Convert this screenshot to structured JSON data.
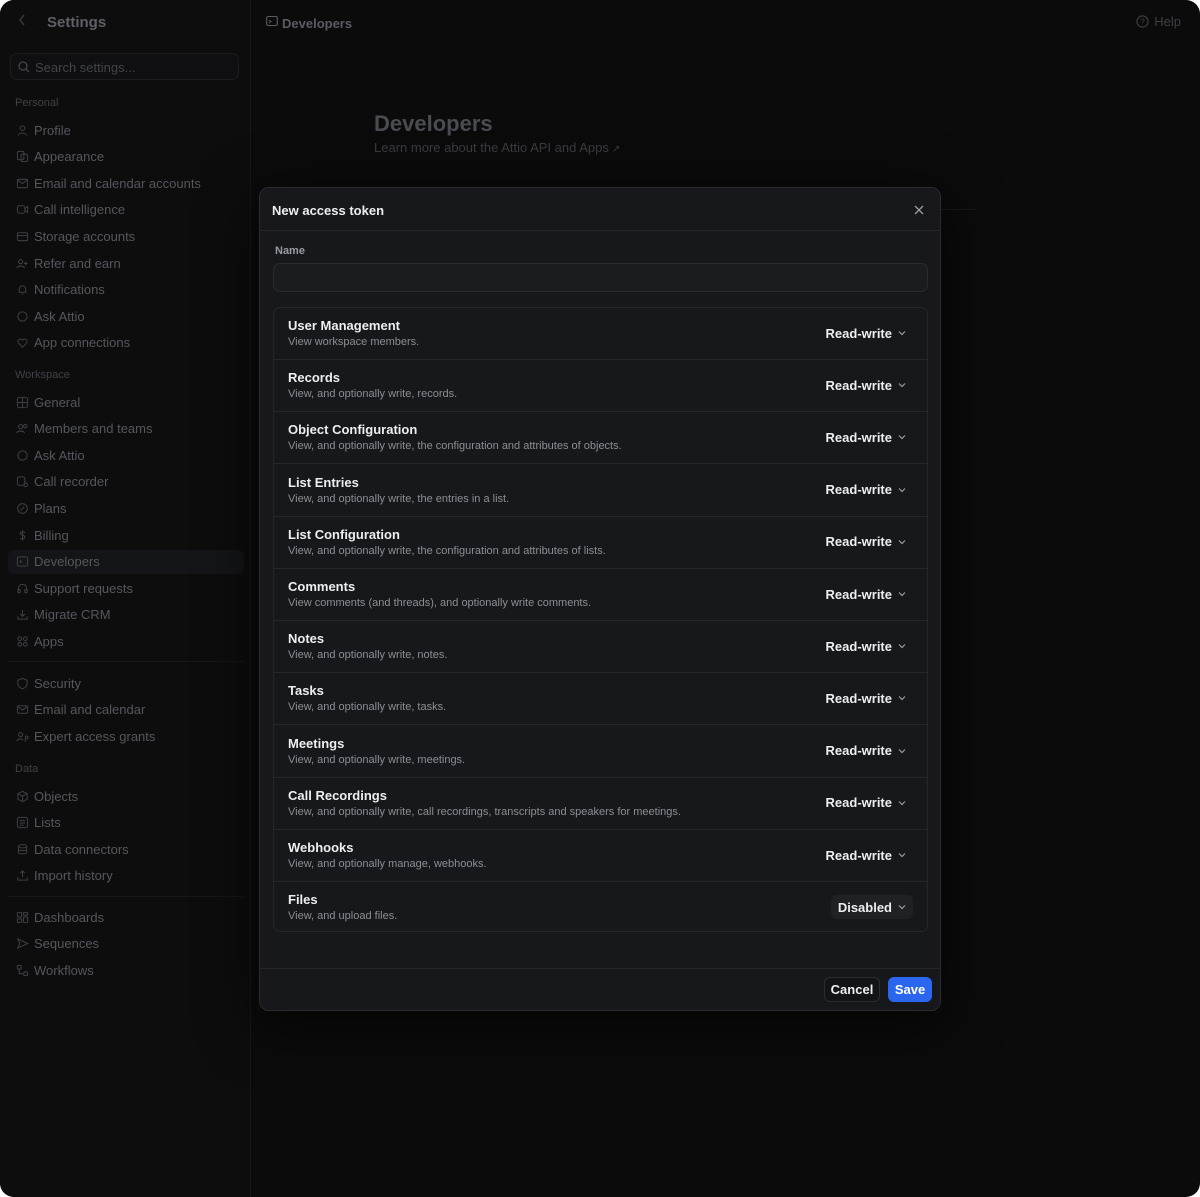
{
  "sidebar": {
    "title": "Settings",
    "search_placeholder": "Search settings...",
    "sections": {
      "personal": "Personal",
      "workspace": "Workspace",
      "data": "Data"
    },
    "personal_items": [
      {
        "label": "Profile",
        "icon": "user-icon"
      },
      {
        "label": "Appearance",
        "icon": "appearance-icon"
      },
      {
        "label": "Email and calendar accounts",
        "icon": "mail-calendar-icon"
      },
      {
        "label": "Call intelligence",
        "icon": "video-icon"
      },
      {
        "label": "Storage accounts",
        "icon": "storage-icon"
      },
      {
        "label": "Refer and earn",
        "icon": "refer-icon"
      },
      {
        "label": "Notifications",
        "icon": "bell-icon"
      },
      {
        "label": "Ask Attio",
        "icon": "chat-icon"
      },
      {
        "label": "App connections",
        "icon": "heart-icon"
      }
    ],
    "workspace_items": [
      {
        "label": "General",
        "icon": "grid-icon"
      },
      {
        "label": "Members and teams",
        "icon": "users-icon"
      },
      {
        "label": "Ask Attio",
        "icon": "chat-icon"
      },
      {
        "label": "Call recorder",
        "icon": "call-recorder-icon"
      },
      {
        "label": "Plans",
        "icon": "plans-icon"
      },
      {
        "label": "Billing",
        "icon": "dollar-icon"
      },
      {
        "label": "Developers",
        "icon": "developers-icon"
      },
      {
        "label": "Support requests",
        "icon": "headset-icon"
      },
      {
        "label": "Migrate CRM",
        "icon": "download-icon"
      },
      {
        "label": "Apps",
        "icon": "apps-icon"
      }
    ],
    "security_items": [
      {
        "label": "Security",
        "icon": "shield-icon"
      },
      {
        "label": "Email and calendar",
        "icon": "mail-icon"
      },
      {
        "label": "Expert access grants",
        "icon": "user-key-icon"
      }
    ],
    "data_items": [
      {
        "label": "Objects",
        "icon": "cube-icon"
      },
      {
        "label": "Lists",
        "icon": "list-icon"
      },
      {
        "label": "Data connectors",
        "icon": "database-icon"
      },
      {
        "label": "Import history",
        "icon": "upload-icon"
      }
    ],
    "other_items": [
      {
        "label": "Dashboards",
        "icon": "dashboard-icon"
      },
      {
        "label": "Sequences",
        "icon": "send-icon"
      },
      {
        "label": "Workflows",
        "icon": "workflow-icon"
      }
    ]
  },
  "topbar": {
    "breadcrumb": "Developers",
    "help": "Help"
  },
  "page": {
    "title": "Developers",
    "subtitle": "Learn more about the Attio API and Apps",
    "subtitle_arrow": "↗"
  },
  "modal": {
    "title": "New access token",
    "name_label": "Name",
    "name_value": "",
    "scopes": [
      {
        "name": "User Management",
        "description": "View workspace members.",
        "value": "Read-write"
      },
      {
        "name": "Records",
        "description": "View, and optionally write, records.",
        "value": "Read-write"
      },
      {
        "name": "Object Configuration",
        "description": "View, and optionally write, the configuration and attributes of objects.",
        "value": "Read-write"
      },
      {
        "name": "List Entries",
        "description": "View, and optionally write, the entries in a list.",
        "value": "Read-write"
      },
      {
        "name": "List Configuration",
        "description": "View, and optionally write, the configuration and attributes of lists.",
        "value": "Read-write"
      },
      {
        "name": "Comments",
        "description": "View comments (and threads), and optionally write comments.",
        "value": "Read-write"
      },
      {
        "name": "Notes",
        "description": "View, and optionally write, notes.",
        "value": "Read-write"
      },
      {
        "name": "Tasks",
        "description": "View, and optionally write, tasks.",
        "value": "Read-write"
      },
      {
        "name": "Meetings",
        "description": "View, and optionally write, meetings.",
        "value": "Read-write"
      },
      {
        "name": "Call Recordings",
        "description": "View, and optionally write, call recordings, transcripts and speakers for meetings.",
        "value": "Read-write"
      },
      {
        "name": "Webhooks",
        "description": "View, and optionally manage, webhooks.",
        "value": "Read-write"
      },
      {
        "name": "Files",
        "description": "View, and upload files.",
        "value": "Disabled"
      }
    ],
    "cancel_label": "Cancel",
    "save_label": "Save"
  },
  "colors": {
    "background": "#0b0b0c",
    "modal_background": "#17181b",
    "primary_button": "#2b66ee",
    "text_primary": "#eceef1",
    "text_secondary": "#8c8e95"
  }
}
